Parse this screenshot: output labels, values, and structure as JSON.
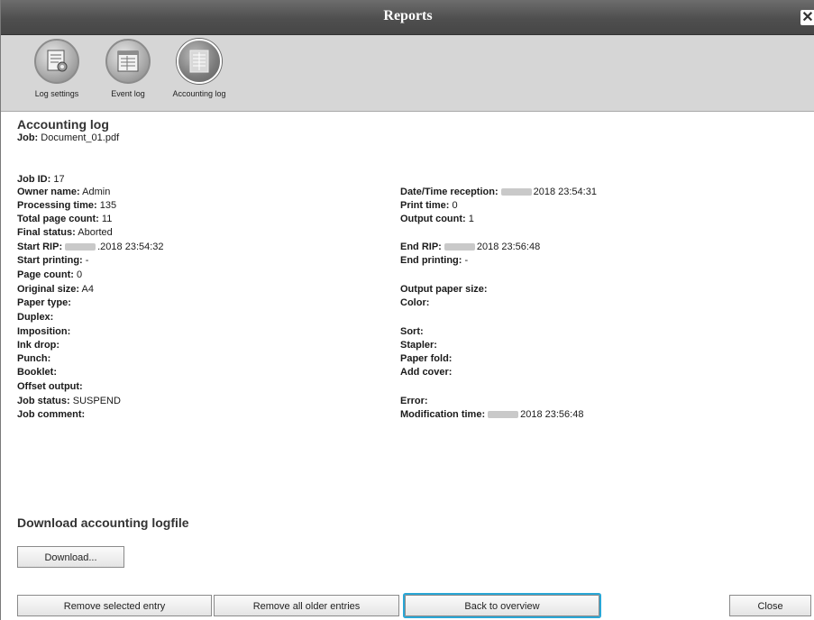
{
  "window": {
    "title": "Reports",
    "close_glyph": "✕"
  },
  "toolbar": {
    "items": [
      {
        "label": "Log settings",
        "icon": "log-settings-icon",
        "active": false
      },
      {
        "label": "Event log",
        "icon": "event-log-icon",
        "active": false
      },
      {
        "label": "Accounting log",
        "icon": "accounting-log-icon",
        "active": true
      }
    ]
  },
  "section": {
    "title": "Accounting log",
    "job_label": "Job:",
    "job_value": "Document_01.pdf"
  },
  "left_fields": [
    {
      "key": "Job ID:",
      "value": "17"
    },
    {
      "key": "Owner name:",
      "value": "Admin"
    },
    {
      "key": "Processing time:",
      "value": "135"
    },
    {
      "key": "Total page count:",
      "value": "11"
    },
    {
      "key": "Final status:",
      "value": "Aborted"
    },
    {
      "key": "Start RIP:",
      "value": ".2018 23:54:32",
      "redacted": true
    },
    {
      "key": "Start printing:",
      "value": "-"
    },
    {
      "key": "Page count:",
      "value": "0"
    },
    {
      "key": "Original size:",
      "value": "A4"
    },
    {
      "key": "Paper type:",
      "value": ""
    },
    {
      "key": "Duplex:",
      "value": ""
    },
    {
      "key": "Imposition:",
      "value": ""
    },
    {
      "key": "Ink drop:",
      "value": ""
    },
    {
      "key": "Punch:",
      "value": ""
    },
    {
      "key": "Booklet:",
      "value": ""
    },
    {
      "key": "Offset output:",
      "value": ""
    },
    {
      "key": "Job status:",
      "value": "SUSPEND"
    },
    {
      "key": "Job comment:",
      "value": ""
    }
  ],
  "right_fields": [
    {
      "key": "Date/Time reception:",
      "value": "2018 23:54:31",
      "redacted": true
    },
    {
      "key": "Print time:",
      "value": "0"
    },
    {
      "key": "Output count:",
      "value": "1"
    },
    {
      "key": "End RIP:",
      "value": "2018 23:56:48",
      "redacted": true
    },
    {
      "key": "End printing:",
      "value": "-"
    },
    {
      "key": "Output paper size:",
      "value": ""
    },
    {
      "key": "Color:",
      "value": ""
    },
    {
      "key": "Sort:",
      "value": ""
    },
    {
      "key": "Stapler:",
      "value": ""
    },
    {
      "key": "Paper fold:",
      "value": ""
    },
    {
      "key": "Add cover:",
      "value": ""
    },
    {
      "key": "Error:",
      "value": ""
    },
    {
      "key": "Modification time:",
      "value": "2018 23:56:48",
      "redacted": true
    }
  ],
  "download": {
    "title": "Download accounting logfile",
    "button_label": "Download..."
  },
  "buttons": {
    "remove_selected": "Remove selected entry",
    "remove_older": "Remove all older entries",
    "back": "Back to overview",
    "close": "Close"
  },
  "colors": {
    "focus_ring": "#2aa7d6",
    "titlebar": "#555555",
    "toolbar": "#d6d6d6"
  }
}
